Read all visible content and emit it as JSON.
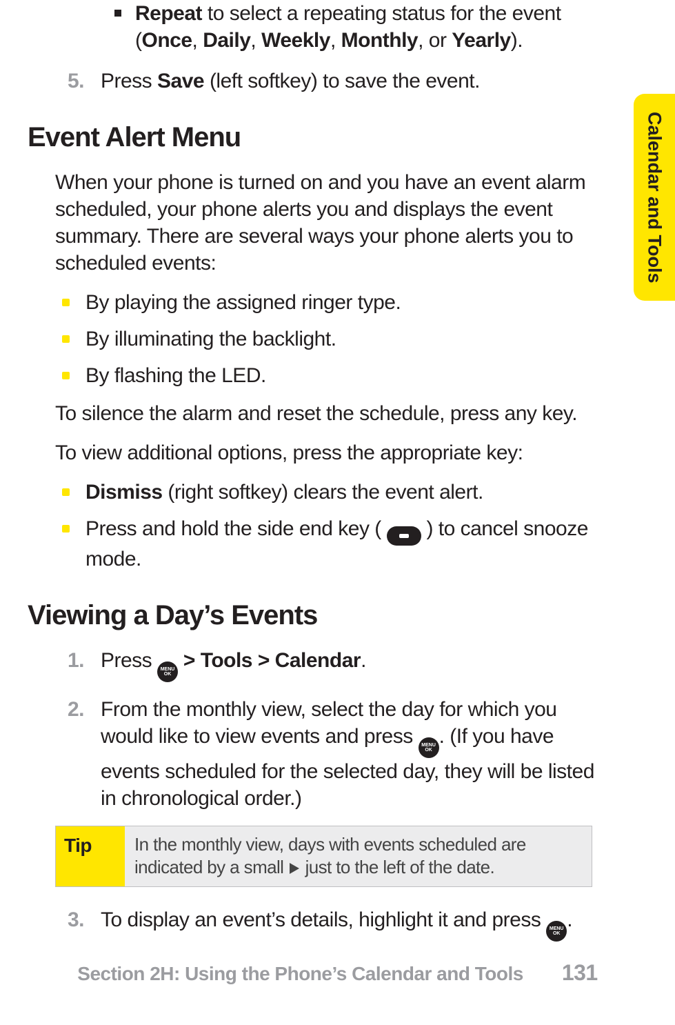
{
  "side_tab": "Calendar and Tools",
  "intro_bullet": {
    "lead": "Repeat ",
    "rest": "to select a repeating status for the event (",
    "opt1": "Once",
    "sep": ", ",
    "opt2": "Daily",
    "opt3": "Weekly",
    "opt4": "Monthly",
    "or": ", or ",
    "opt5": "Yearly",
    "end": ")."
  },
  "step5": {
    "num": "5.",
    "t1": "Press ",
    "b1": "Save",
    "t2": " (left softkey) to save the event."
  },
  "sec1": {
    "title": "Event Alert Menu",
    "para": "When your phone is turned on and you have an event alarm scheduled, your phone alerts you and displays the event summary. There are several ways your phone alerts you to scheduled events:",
    "bul1": "By playing the assigned ringer type.",
    "bul2": "By illuminating the backlight.",
    "bul3": "By flashing the LED.",
    "para2": "To silence the alarm and reset the schedule, press any key.",
    "para3": "To view additional options, press the appropriate key:",
    "opt1_b": "Dismiss",
    "opt1_r": " (right softkey) clears the event alert.",
    "opt2_a": "Press and hold the side end key ( ",
    "opt2_b": " ) to cancel snooze mode."
  },
  "sec2": {
    "title": "Viewing a Day’s Events",
    "s1": {
      "num": "1.",
      "a": "Press ",
      "b": " > Tools > Calendar",
      "c": "."
    },
    "s2": {
      "num": "2.",
      "a": "From the monthly view, select the day for which you would like to view events and press ",
      "b": ". (If you have events scheduled for the selected day, they will be listed in chronological order.)"
    },
    "tip_label": "Tip",
    "tip_a": "In the monthly view, days with events scheduled are indicated by a small ",
    "tip_b": " just to the left of the date.",
    "s3": {
      "num": "3.",
      "a": "To display an event’s details, highlight it and press ",
      "b": "."
    }
  },
  "menu_ok": {
    "l1": "MENU",
    "l2": "OK"
  },
  "footer": {
    "section": "Section 2H: Using the Phone’s Calendar and Tools",
    "page": "131"
  }
}
